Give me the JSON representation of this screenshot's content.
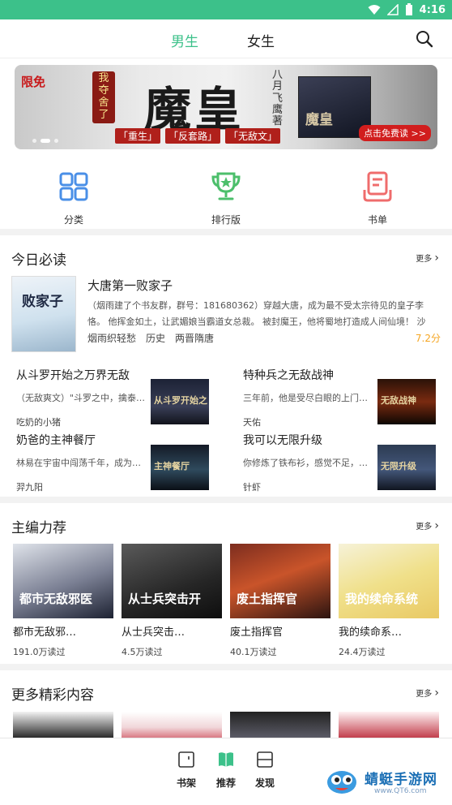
{
  "status_bar": {
    "time": "4:16"
  },
  "top_nav": {
    "tabs": [
      "男生",
      "女生"
    ],
    "active_tab": "男生"
  },
  "banner": {
    "badge": "限免",
    "author_tag": "我夺舍了",
    "title": "魔皇",
    "author_vertical": "八月飞鹰著",
    "tags": [
      "「重生」",
      "「反套路」",
      "「无敌文」"
    ],
    "mini_cover_title": "魔皇",
    "cta": "点击免费读 >>",
    "slide_count": 3,
    "active_slide": 2
  },
  "categories": [
    {
      "label": "分类",
      "icon": "grid-icon",
      "color": "#4a8fe7"
    },
    {
      "label": "排行版",
      "icon": "trophy-icon",
      "color": "#4cbf6b"
    },
    {
      "label": "书单",
      "icon": "booklist-icon",
      "color": "#ef6c6c"
    }
  ],
  "today": {
    "title": "今日必读",
    "more": "更多",
    "featured": {
      "title": "大唐第一败家子",
      "cover_text": "败家子",
      "desc": "（烟雨建了个书友群，群号：181680362）穿越大唐，成为最不受太宗待见的皇子李恪。 他挥金如土，让武媚娘当霸道女总裁。 被封魔王，他将蜀地打造成人间仙境！ 沙滩、温泉、游乐场，……",
      "tags": [
        "烟雨织轻愁",
        "历史",
        "两晋隋唐"
      ],
      "score": "7.2分"
    },
    "items": [
      {
        "title": "从斗罗开始之万界无敌",
        "desc": "（无敌爽文）\"斗罗之中，擒泰…",
        "author": "吃奶的小猪",
        "thumb_caption": "从斗罗开始之"
      },
      {
        "title": "特种兵之无敌战神",
        "desc": "三年前，他是受尽白眼的上门赘…",
        "author": "天佑",
        "thumb_caption": "无敌战神"
      },
      {
        "title": "奶爸的主神餐厅",
        "desc": "林易在宇宙中闯荡千年，成为至…",
        "author": "羿九阳",
        "thumb_caption": "主神餐厅"
      },
      {
        "title": "我可以无限升级",
        "desc": "你修炼了铁布衫，感觉不足，铁…",
        "author": "针虾",
        "thumb_caption": "无限升级"
      }
    ]
  },
  "editor": {
    "title": "主编力荐",
    "more": "更多",
    "books": [
      {
        "name": "都市无敌邪…",
        "reads": "191.0万读过",
        "cover_text": "都市无敌邪医"
      },
      {
        "name": "从士兵突击…",
        "reads": "4.5万读过",
        "cover_text": "从士兵突击开"
      },
      {
        "name": "废土指挥官",
        "reads": "40.1万读过",
        "cover_text": "废土指挥官"
      },
      {
        "name": "我的续命系…",
        "reads": "24.4万读过",
        "cover_text": "我的续命系统"
      }
    ]
  },
  "more_content": {
    "title": "更多精彩内容",
    "more": "更多"
  },
  "bottom_nav": [
    {
      "label": "书架",
      "icon": "bookshelf-icon"
    },
    {
      "label": "推荐",
      "icon": "recommend-icon"
    },
    {
      "label": "发现",
      "icon": "discover-icon"
    }
  ],
  "watermark": {
    "name": "蜻蜓手游网",
    "domain": "www.QT6.com"
  }
}
